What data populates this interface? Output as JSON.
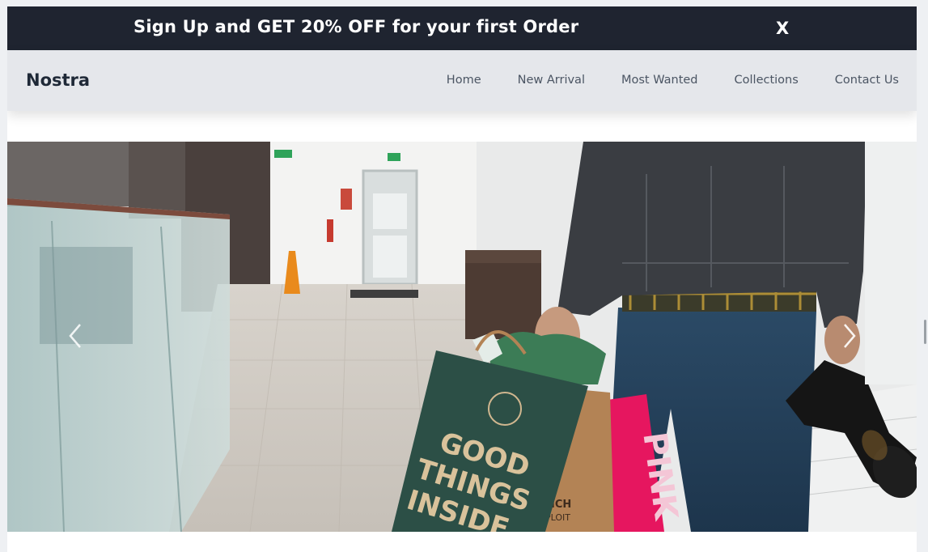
{
  "promo": {
    "text": "Sign Up and GET 20% OFF for your first Order",
    "close_label": "X"
  },
  "navbar": {
    "brand": "Nostra",
    "links": [
      "Home",
      "New Arrival",
      "Most Wanted",
      "Collections",
      "Contact Us"
    ]
  },
  "hero": {
    "bag_text": [
      "GOOD",
      "THINGS",
      "INSIDE"
    ],
    "pink_bag_text": "PINK",
    "prev_icon": "chevron-left-icon",
    "next_icon": "chevron-right-icon"
  },
  "colors": {
    "promo_bg": "#1f2430",
    "navbar_bg": "#e5e7eb",
    "brand_text": "#1f2937",
    "nav_text": "#4b5563"
  }
}
